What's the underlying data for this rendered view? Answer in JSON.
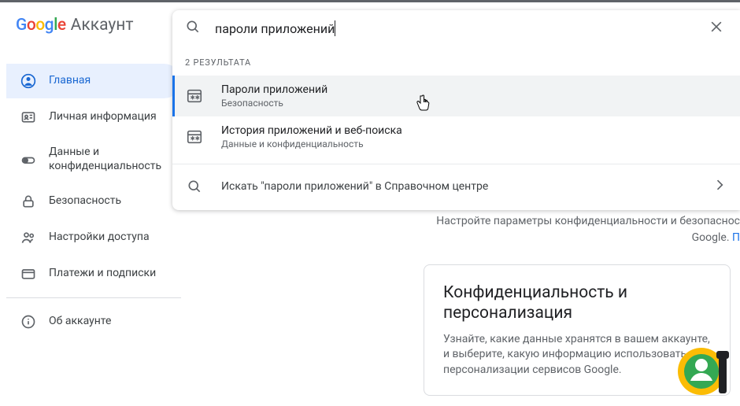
{
  "header": {
    "google_logo_letters": [
      "G",
      "o",
      "o",
      "g",
      "l",
      "e"
    ],
    "account_label": "Аккаунт"
  },
  "sidebar": {
    "items": [
      {
        "label": "Главная",
        "icon": "user-circle-icon",
        "active": true
      },
      {
        "label": "Личная информация",
        "icon": "id-card-icon",
        "active": false
      },
      {
        "label": "Данные и конфиденциальность",
        "icon": "toggle-icon",
        "active": false
      },
      {
        "label": "Безопасность",
        "icon": "lock-icon",
        "active": false
      },
      {
        "label": "Настройки доступа",
        "icon": "people-icon",
        "active": false
      },
      {
        "label": "Платежи и подписки",
        "icon": "card-icon",
        "active": false
      }
    ],
    "about": {
      "label": "Об аккаунте",
      "icon": "info-icon"
    }
  },
  "search": {
    "value": "пароли приложений",
    "results_header": "2 РЕЗУЛЬТАТА",
    "results": [
      {
        "title": "Пароли приложений",
        "sub": "Безопасность",
        "icon": "asterisk-list-icon",
        "highlighted": true
      },
      {
        "title": "История приложений и веб-поиска",
        "sub": "Данные и конфиденциальность",
        "icon": "asterisk-list-icon",
        "highlighted": false
      }
    ],
    "help_text": "Искать \"пароли приложений\" в Справочном центре"
  },
  "background": {
    "desc_line1": "Настройте параметры конфиденциальности и безопаснос",
    "desc_line2_prefix": "Google. ",
    "desc_line2_link": "П"
  },
  "card": {
    "title": "Конфиденциальность и персонализация",
    "desc": "Узнайте, какие данные хранятся в вашем аккаунте, и выберите, какую информацию использовать для персонализации сервисов Google."
  }
}
